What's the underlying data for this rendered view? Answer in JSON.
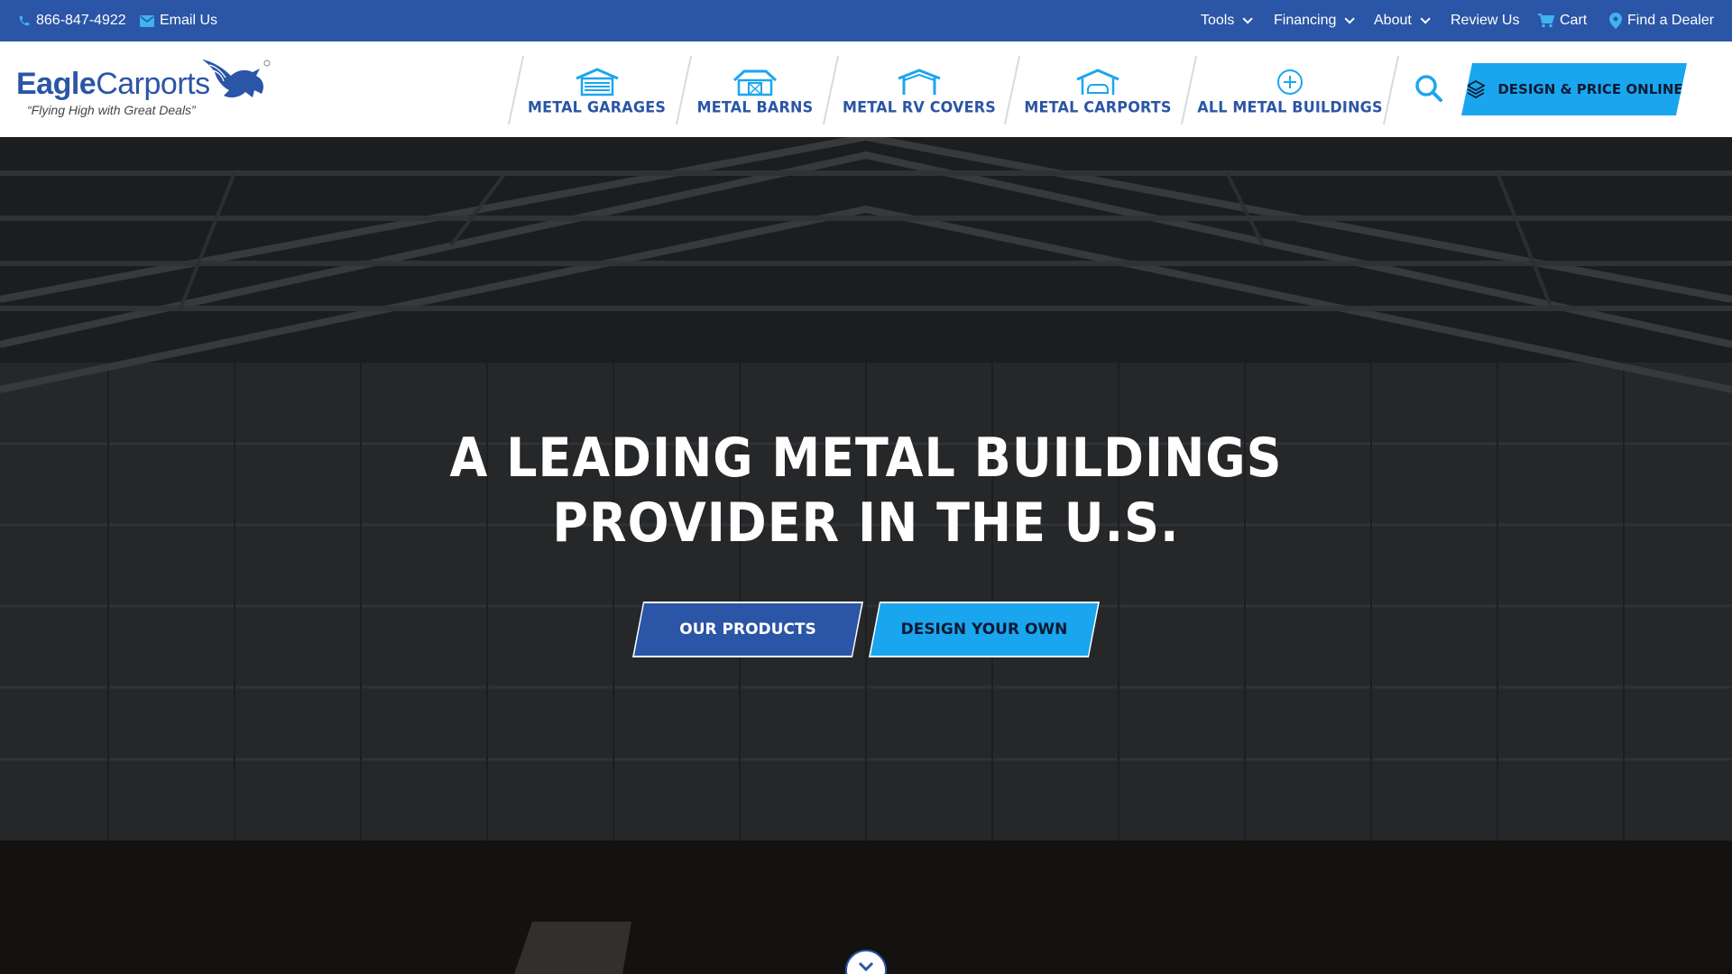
{
  "topbar": {
    "phone": "866-847-4922",
    "email_label": "Email Us",
    "tools_label": "Tools",
    "financing_label": "Financing",
    "about_label": "About",
    "review_label": "Review Us",
    "cart_label": "Cart",
    "dealer_label": "Find a Dealer"
  },
  "logo": {
    "word_1": "Eagle",
    "word_2": "Carports",
    "tagline": "“Flying High with Great Deals”"
  },
  "nav": {
    "items": [
      {
        "label": "METAL GARAGES",
        "icon": "garage-icon"
      },
      {
        "label": "METAL BARNS",
        "icon": "barn-icon"
      },
      {
        "label": "METAL RV COVERS",
        "icon": "rv-cover-icon"
      },
      {
        "label": "METAL CARPORTS",
        "icon": "carport-icon"
      },
      {
        "label": "ALL METAL BUILDINGS",
        "icon": "plus-circle-icon"
      }
    ],
    "cta_label": "DESIGN & PRICE ONLINE"
  },
  "hero": {
    "title_line_1": "A LEADING METAL BUILDINGS",
    "title_line_2": "PROVIDER IN THE U.S.",
    "primary_button": "OUR PRODUCTS",
    "secondary_button": "DESIGN YOUR OWN"
  },
  "colors": {
    "brand_blue": "#2b55a6",
    "accent_cyan": "#1aa6ee",
    "white": "#ffffff"
  }
}
